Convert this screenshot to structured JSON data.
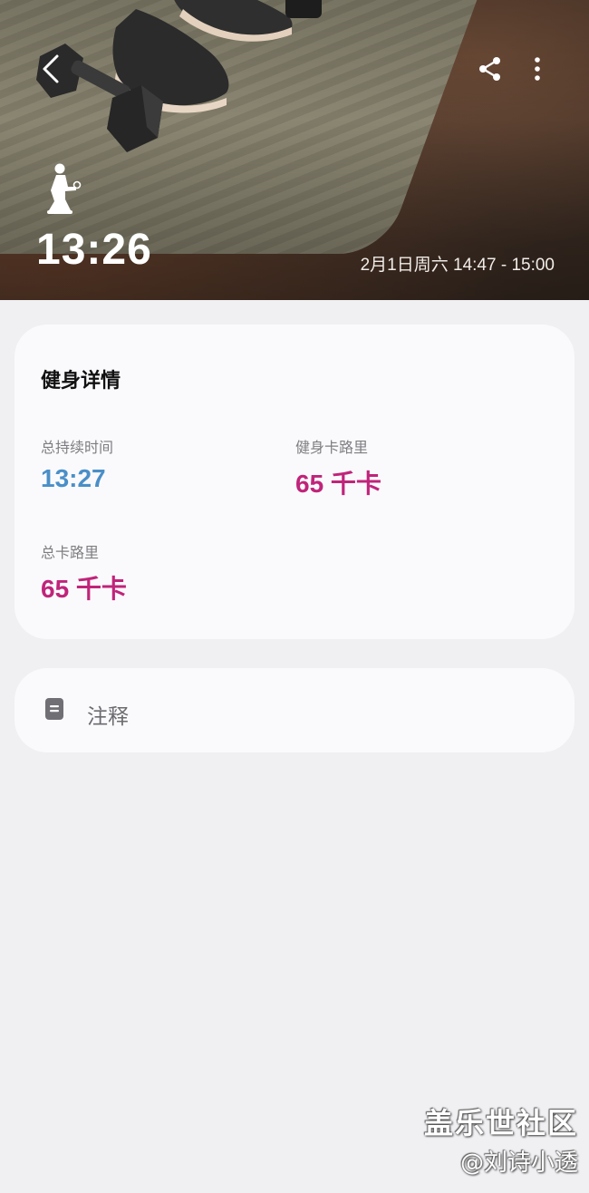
{
  "header": {
    "duration": "13:26",
    "time_range": "2月1日周六 14:47 - 15:00",
    "icons": {
      "back": "chevron-left-icon",
      "share": "share-icon",
      "more": "more-vertical-icon",
      "workout": "squat-exercise-icon"
    }
  },
  "details": {
    "title": "健身详情",
    "metrics": [
      {
        "label": "总持续时间",
        "value": "13:27",
        "color": "#4a8fc8"
      },
      {
        "label": "健身卡路里",
        "value": "65 千卡",
        "color": "#c0247a"
      },
      {
        "label": "总卡路里",
        "value": "65 千卡",
        "color": "#c0247a"
      }
    ]
  },
  "notes": {
    "label": "注释",
    "icon": "note-icon"
  },
  "watermark": {
    "line1": "盖乐世社区",
    "line2": "@刘诗小透"
  }
}
